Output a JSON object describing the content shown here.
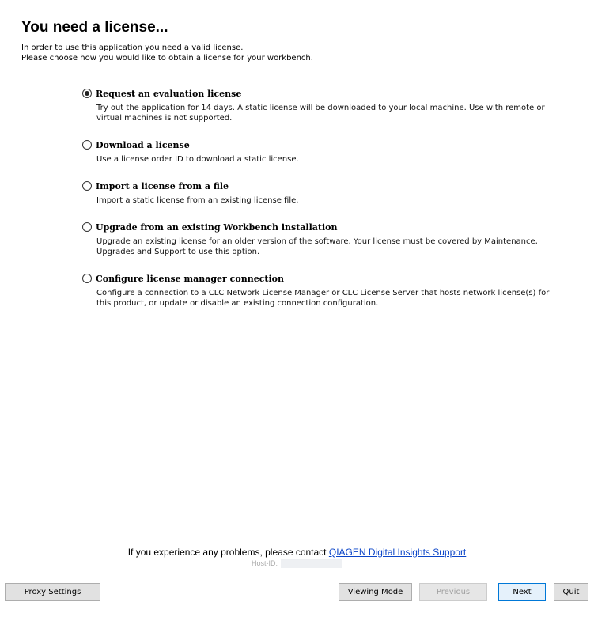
{
  "page": {
    "title": "You need a license...",
    "intro_lines": [
      "In order to use this application you need a valid license.",
      "Please choose how you would like to obtain a license for your workbench."
    ]
  },
  "options": [
    {
      "label": "Request an evaluation license",
      "description": "Try out the application for 14 days. A static license will be downloaded to your local machine. Use with remote or virtual machines is not supported.",
      "selected": true
    },
    {
      "label": "Download a license",
      "description": "Use a license order ID to download a static license.",
      "selected": false
    },
    {
      "label": "Import a license from a file",
      "description": "Import a static license from an existing license file.",
      "selected": false
    },
    {
      "label": "Upgrade from an existing Workbench installation",
      "description": "Upgrade an existing license for an older version of the software. Your license must be covered by Maintenance, Upgrades and Support to use this option.",
      "selected": false
    },
    {
      "label": "Configure license manager connection",
      "description": "Configure a connection to a CLC Network License Manager or CLC License Server that hosts network license(s) for this product, or update or disable an existing connection configuration.",
      "selected": false
    }
  ],
  "support": {
    "text": "If you experience any problems, please contact",
    "link": "QIAGEN Digital Insights Support"
  },
  "host": {
    "label": "Host-ID:"
  },
  "buttons": {
    "proxy": "Proxy Settings",
    "viewing_mode": "Viewing Mode",
    "previous": "Previous",
    "next": "Next",
    "quit": "Quit"
  },
  "colors": {
    "link": "#0a44c8",
    "default_button_border": "#0078d7"
  }
}
